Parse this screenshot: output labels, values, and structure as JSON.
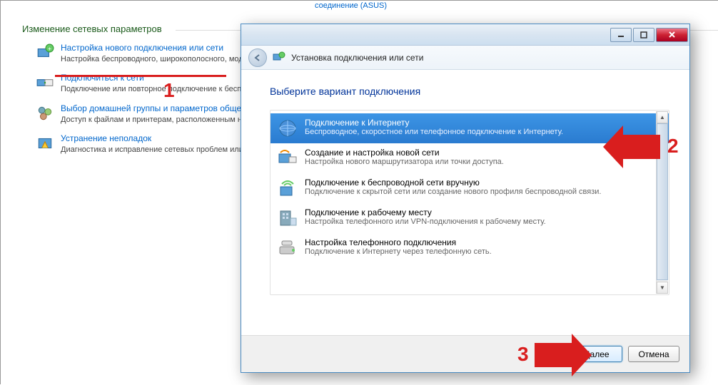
{
  "background": {
    "top_link": "соединение (ASUS)",
    "section_header": "Изменение сетевых параметров",
    "items": [
      {
        "link": "Настройка нового подключения или сети",
        "desc": "Настройка беспроводного, широкополосного, модемного, прямого или VPN-подключения или же настройка маршрутизатора или точки доступа."
      },
      {
        "link": "Подключиться к сети",
        "desc": "Подключение или повторное подключение к беспроводному, проводному, модемному сетевому соединению или подключение к VPN."
      },
      {
        "link": "Выбор домашней группы и параметров общего доступа",
        "desc": "Доступ к файлам и принтерам, расположенным на других сетевых компьютерах, или изменение параметров общего доступа."
      },
      {
        "link": "Устранение неполадок",
        "desc": "Диагностика и исправление сетевых проблем или получение сведений об исправлении."
      }
    ]
  },
  "dialog": {
    "nav_title": "Установка подключения или сети",
    "heading": "Выберите вариант подключения",
    "options": [
      {
        "title": "Подключение к Интернету",
        "desc": "Беспроводное, скоростное или телефонное подключение к Интернету.",
        "selected": true
      },
      {
        "title": "Создание и настройка новой сети",
        "desc": "Настройка нового маршрутизатора или точки доступа.",
        "selected": false
      },
      {
        "title": "Подключение к беспроводной сети вручную",
        "desc": "Подключение к скрытой сети или создание нового профиля беспроводной связи.",
        "selected": false
      },
      {
        "title": "Подключение к рабочему месту",
        "desc": "Настройка телефонного или VPN-подключения к рабочему месту.",
        "selected": false
      },
      {
        "title": "Настройка телефонного подключения",
        "desc": "Подключение к Интернету через телефонную сеть.",
        "selected": false
      }
    ],
    "buttons": {
      "next": "Далее",
      "cancel": "Отмена"
    }
  },
  "annotations": {
    "n1": "1",
    "n2": "2",
    "n3": "3"
  }
}
